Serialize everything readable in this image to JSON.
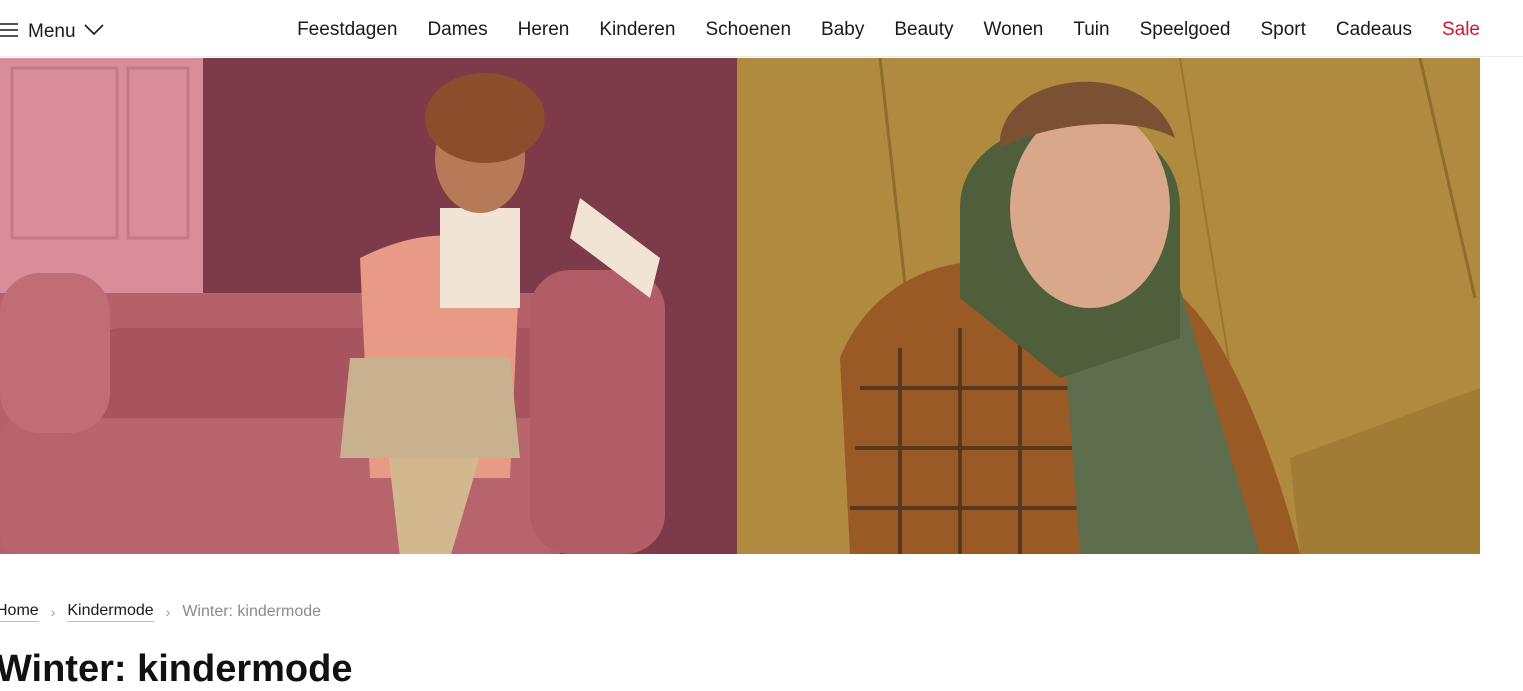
{
  "header": {
    "menu_label": "Menu",
    "nav": [
      {
        "label": "Feestdagen"
      },
      {
        "label": "Dames"
      },
      {
        "label": "Heren"
      },
      {
        "label": "Kinderen"
      },
      {
        "label": "Schoenen"
      },
      {
        "label": "Baby"
      },
      {
        "label": "Beauty"
      },
      {
        "label": "Wonen"
      },
      {
        "label": "Tuin"
      },
      {
        "label": "Speelgoed"
      },
      {
        "label": "Sport"
      },
      {
        "label": "Cadeaus"
      },
      {
        "label": "Sale"
      }
    ],
    "sale_color": "#d5142a"
  },
  "hero": {
    "left_panel_icon": "girl-on-pink-sofa-photo",
    "right_panel_icon": "boy-in-plaid-jacket-photo"
  },
  "breadcrumb": {
    "items": [
      {
        "label": "Home"
      },
      {
        "label": "Kindermode"
      }
    ],
    "current": "Winter: kindermode"
  },
  "page": {
    "title": "Winter: kindermode"
  }
}
